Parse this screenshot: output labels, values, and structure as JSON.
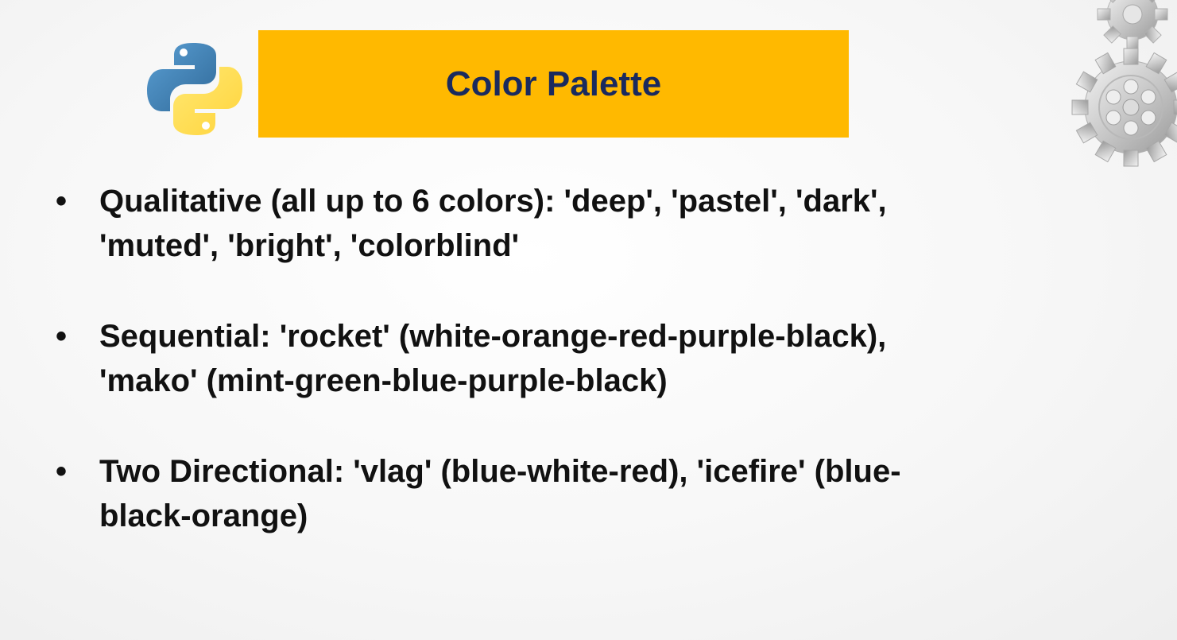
{
  "slide": {
    "title": "Color Palette",
    "bullets": [
      {
        "line1": "Qualitative (all up to 6 colors): 'deep', 'pastel', 'dark',",
        "line2": "'muted', 'bright', 'colorblind'"
      },
      {
        "line1": "Sequential: 'rocket' (white-orange-red-purple-black),",
        "line2": "'mako' (mint-green-blue-purple-black)"
      },
      {
        "line1": "Two Directional: 'vlag' (blue-white-red), 'icefire' (blue-",
        "line2": "black-orange)"
      }
    ],
    "bullet_glyph": "•"
  },
  "colors": {
    "banner": "#ffb900",
    "title_text": "#1a2a5e",
    "body_text": "#111111",
    "python_blue": "#3776ab",
    "python_yellow": "#ffd43b"
  },
  "icons": {
    "logo": "python-logo-icon",
    "decoration": "gears-icon"
  }
}
